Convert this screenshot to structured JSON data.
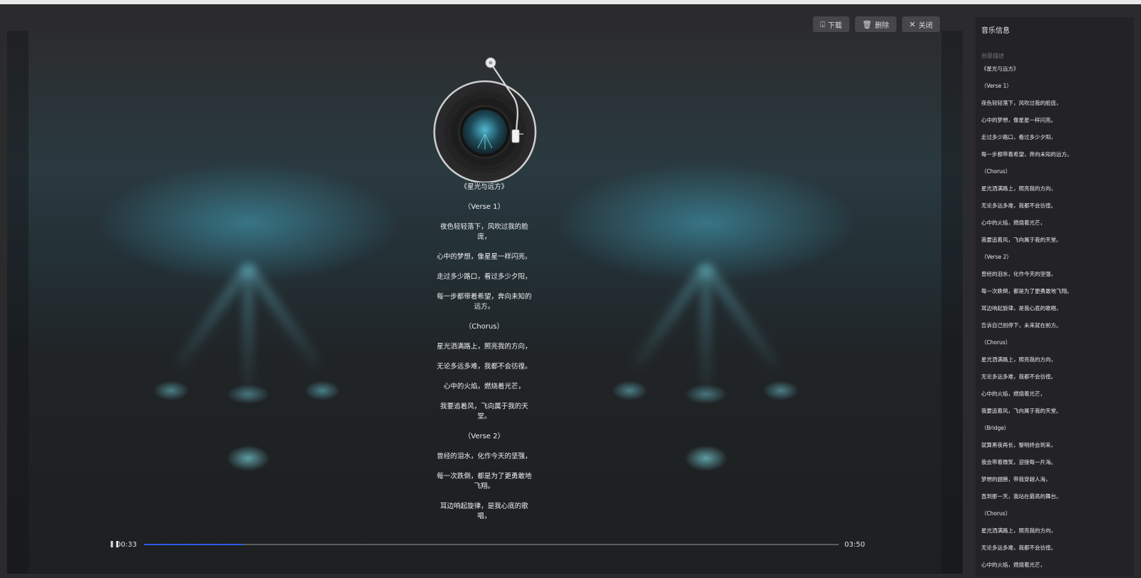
{
  "actions": {
    "download": "下载",
    "delete": "删除",
    "close": "关闭"
  },
  "lyrics": [
    "《星光与远方》",
    "（Verse 1）",
    "夜色轻轻落下，风吹过我的脸庞，",
    "心中的梦想，像星星一样闪亮。",
    "走过多少路口，看过多少夕阳，",
    "每一步都带着希望，奔向未知的远方。",
    "（Chorus）",
    "星光洒满路上，照亮我的方向，",
    "无论多远多难，我都不会彷徨。",
    "心中的火焰，燃烧着光芒，",
    "我要追着风，飞向属于我的天堂。",
    "（Verse 2）",
    "曾经的泪水，化作今天的坚强，",
    "每一次跌倒，都是为了更勇敢地飞翔。",
    "耳边响起旋律，是我心底的歌唱，"
  ],
  "player": {
    "current_time": "00:33",
    "total_time": "03:50",
    "progress": 0.143
  },
  "sidebar": {
    "title": "音乐信息",
    "subtitle": "创意描述",
    "lines": [
      "《星光与远方》",
      "（Verse 1）",
      "夜色轻轻落下，风吹过我的脸庞，",
      "心中的梦想，像星星一样闪亮。",
      "走过多少路口，看过多少夕阳，",
      "每一步都带着希望，奔向未知的远方。",
      "（Chorus）",
      "星光洒满路上，照亮我的方向，",
      "无论多远多难，我都不会彷徨。",
      "心中的火焰，燃烧着光芒，",
      "我要追着风，飞向属于我的天堂。",
      "（Verse 2）",
      "曾经的泪水，化作今天的坚强，",
      "每一次跌倒，都是为了更勇敢地飞翔。",
      "耳边响起旋律，是我心底的歌唱，",
      "告诉自己别停下，未来就在前方。",
      "（Chorus）",
      "星光洒满路上，照亮我的方向，",
      "无论多远多难，我都不会彷徨。",
      "心中的火焰，燃烧着光芒，",
      "我要追着风，飞向属于我的天堂。",
      "（Bridge）",
      "就算黑夜再长，黎明终会到来，",
      "我会带着微笑，迎接每一片海。",
      "梦想的翅膀，带我穿越人海，",
      "直到那一天，我站在最高的舞台。",
      "（Chorus）",
      "星光洒满路上，照亮我的方向，",
      "无论多远多难，我都不会彷徨。",
      "心中的火焰，燃烧着光芒，"
    ]
  }
}
